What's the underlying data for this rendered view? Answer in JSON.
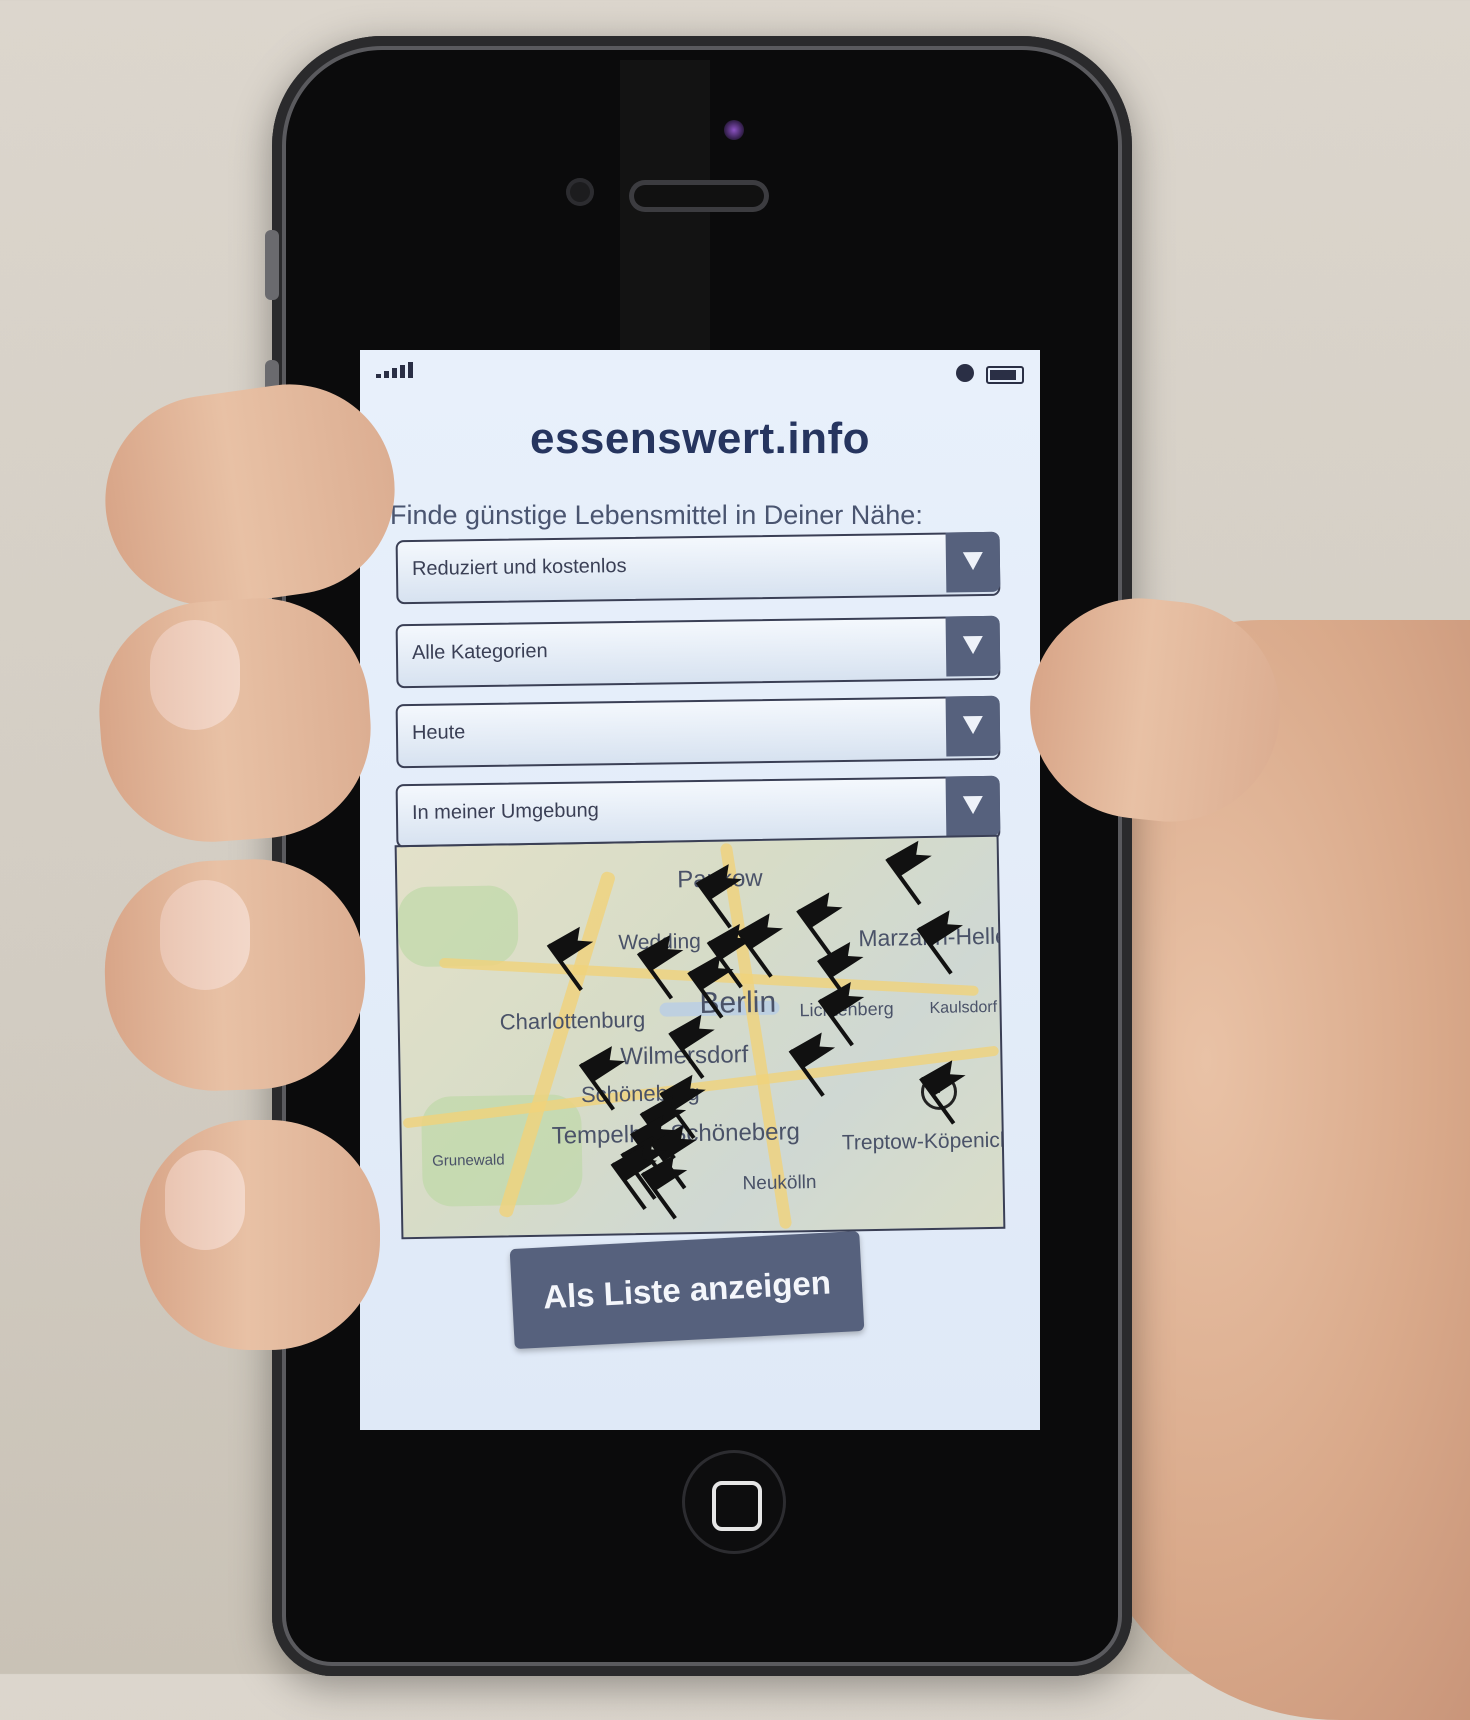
{
  "app": {
    "title": "essenswert.info"
  },
  "search": {
    "intro": "Finde günstige Lebensmittel in Deiner Nähe:"
  },
  "filters": [
    {
      "selected": "Reduziert und kostenlos"
    },
    {
      "selected": "Alle Kategorien"
    },
    {
      "selected": "Heute"
    },
    {
      "selected": "In meiner Umgebung"
    }
  ],
  "map": {
    "labels": [
      "Pankow",
      "Wedding",
      "Berlin",
      "Charlottenburg",
      "Wilmersdorf",
      "Schöneberg",
      "Tempelhof-Schöneberg",
      "Treptow-Köpenick",
      "Marzahn-Hellersdorf",
      "Lichtenberg",
      "Grunewald",
      "Neukölln",
      "Kaulsdorf"
    ],
    "marker_icon": "flag-icon",
    "markers_visible": 22
  },
  "actions": {
    "show_list": "Als Liste anzeigen"
  },
  "colors": {
    "accent": "#56617d",
    "title": "#26355f",
    "screen_bg": "#e8f0fb"
  }
}
